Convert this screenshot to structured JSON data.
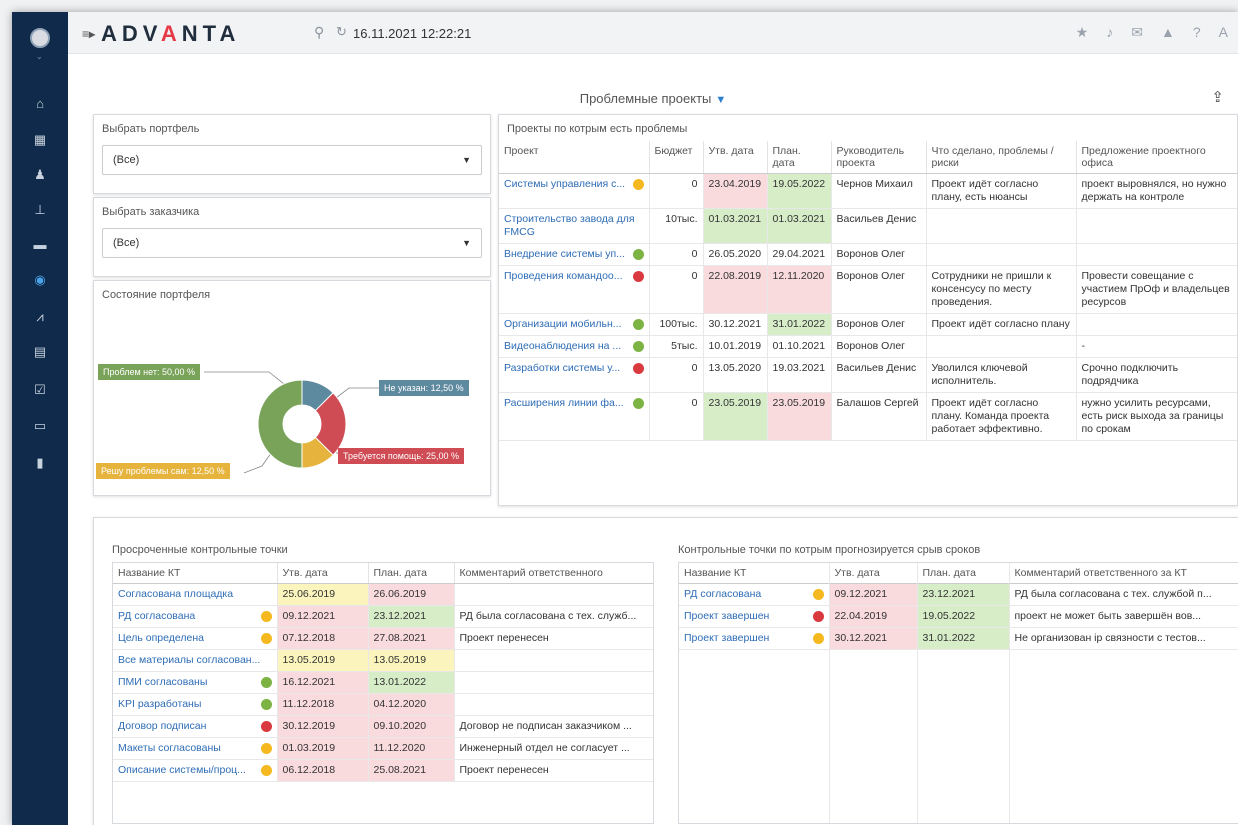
{
  "topbar": {
    "logo_pre": "ADV",
    "logo_a": "A",
    "logo_post": "NTA",
    "datetime": "16.11.2021 12:22:21"
  },
  "page": {
    "title": "Проблемные проекты"
  },
  "filters": {
    "portfolio_label": "Выбрать портфель",
    "portfolio_value": "(Все)",
    "customer_label": "Выбрать заказчика",
    "customer_value": "(Все)"
  },
  "portfolio_state": {
    "title": "Состояние портфеля",
    "labels": {
      "no_problems": "Проблем нет: 50,00 %",
      "not_specified": "Не указан: 12,50 %",
      "help_needed": "Требуется помощь: 25,00 %",
      "self_solve": "Решу проблемы сам: 12,50 %"
    },
    "chart_data": {
      "type": "pie",
      "categories": [
        "Проблем нет",
        "Не указан",
        "Требуется помощь",
        "Решу проблемы сам"
      ],
      "values": [
        50.0,
        12.5,
        25.0,
        12.5
      ],
      "colors": [
        "#7aa35a",
        "#5e8aa0",
        "#d04c55",
        "#e6b43c"
      ]
    }
  },
  "projects": {
    "title": "Проекты по котрым есть проблемы",
    "headers": [
      "Проект",
      "Бюджет",
      "Утв. дата",
      "План. дата",
      "Руководитель проекта",
      "Что сделано, проблемы / риски",
      "Предложение проектного офиса"
    ],
    "rows": [
      {
        "name": "Системы управления с...",
        "dot": "yellow",
        "budget": "0",
        "approved": "23.04.2019",
        "planned": "19.05.2022",
        "manager": "Чернов Михаил",
        "problems": "Проект идёт согласно плану, есть нюансы",
        "proposal": "проект выровнялся, но нужно держать на контроле",
        "approved_bg": "red",
        "planned_bg": "green"
      },
      {
        "name": "Строительство завода для FMCG",
        "dot": "",
        "budget": "10тыс.",
        "approved": "01.03.2021",
        "planned": "01.03.2021",
        "manager": "Васильев Денис",
        "problems": "",
        "proposal": "",
        "approved_bg": "green",
        "planned_bg": "green"
      },
      {
        "name": "Внедрение системы уп...",
        "dot": "green",
        "budget": "0",
        "approved": "26.05.2020",
        "planned": "29.04.2021",
        "manager": "Воронов Олег",
        "problems": "",
        "proposal": "",
        "approved_bg": "",
        "planned_bg": ""
      },
      {
        "name": "Проведения командоо...",
        "dot": "red",
        "budget": "0",
        "approved": "22.08.2019",
        "planned": "12.11.2020",
        "manager": "Воронов Олег",
        "problems": "Сотрудники не пришли к консенсусу по месту проведения.",
        "proposal": "Провести совещание с участием ПрОф и владельцев ресурсов",
        "approved_bg": "red",
        "planned_bg": "red"
      },
      {
        "name": "Организации мобильн...",
        "dot": "green",
        "budget": "100тыс.",
        "approved": "30.12.2021",
        "planned": "31.01.2022",
        "manager": "Воронов Олег",
        "problems": "Проект идёт согласно плану",
        "proposal": "",
        "approved_bg": "",
        "planned_bg": "green"
      },
      {
        "name": "Видеонаблюдения на ...",
        "dot": "green",
        "budget": "5тыс.",
        "approved": "10.01.2019",
        "planned": "01.10.2021",
        "manager": "Воронов Олег",
        "problems": "",
        "proposal": "-",
        "approved_bg": "",
        "planned_bg": ""
      },
      {
        "name": "Разработки системы у...",
        "dot": "red",
        "budget": "0",
        "approved": "13.05.2020",
        "planned": "19.03.2021",
        "manager": "Васильев Денис",
        "problems": "Уволился ключевой исполнитель.",
        "proposal": "Срочно подключить подрядчика",
        "approved_bg": "",
        "planned_bg": ""
      },
      {
        "name": "Расширения линии фа...",
        "dot": "green",
        "budget": "0",
        "approved": "23.05.2019",
        "planned": "23.05.2019",
        "manager": "Балашов Сергей",
        "problems": "Проект идёт согласно плану. Команда проекта работает эффективно.",
        "proposal": "нужно усилить ресурсами, есть риск выхода за границы по срокам",
        "approved_bg": "green",
        "planned_bg": "red"
      }
    ]
  },
  "overdue": {
    "title": "Просроченные контрольные точки",
    "headers": [
      "Название КТ",
      "Утв. дата",
      "План. дата",
      "Комментарий ответственного"
    ],
    "rows": [
      {
        "name": "Согласована площадка",
        "dot": "",
        "approved": "25.06.2019",
        "planned": "26.06.2019",
        "comment": "",
        "approved_bg": "yellow",
        "planned_bg": "red"
      },
      {
        "name": "РД согласована",
        "dot": "yellow",
        "approved": "09.12.2021",
        "planned": "23.12.2021",
        "comment": "РД была согласована с тех. служб...",
        "approved_bg": "red",
        "planned_bg": "green"
      },
      {
        "name": "Цель определена",
        "dot": "yellow",
        "approved": "07.12.2018",
        "planned": "27.08.2021",
        "comment": "Проект перенесен",
        "approved_bg": "red",
        "planned_bg": "red"
      },
      {
        "name": "Все материалы согласован...",
        "dot": "",
        "approved": "13.05.2019",
        "planned": "13.05.2019",
        "comment": "",
        "approved_bg": "yellow",
        "planned_bg": "yellow"
      },
      {
        "name": "ПМИ согласованы",
        "dot": "green",
        "approved": "16.12.2021",
        "planned": "13.01.2022",
        "comment": "",
        "approved_bg": "red",
        "planned_bg": "green"
      },
      {
        "name": "KPI разработаны",
        "dot": "green",
        "approved": "11.12.2018",
        "planned": "04.12.2020",
        "comment": "",
        "approved_bg": "red",
        "planned_bg": "red"
      },
      {
        "name": "Договор подписан",
        "dot": "red",
        "approved": "30.12.2019",
        "planned": "09.10.2020",
        "comment": "Договор не подписан заказчиком ...",
        "approved_bg": "red",
        "planned_bg": "red"
      },
      {
        "name": "Макеты согласованы",
        "dot": "yellow",
        "approved": "01.03.2019",
        "planned": "11.12.2020",
        "comment": "Инженерный отдел не согласует ...",
        "approved_bg": "red",
        "planned_bg": "red"
      },
      {
        "name": "Описание системы/проц...",
        "dot": "yellow",
        "approved": "06.12.2018",
        "planned": "25.08.2021",
        "comment": "Проект перенесен",
        "approved_bg": "red",
        "planned_bg": "red"
      }
    ]
  },
  "forecast": {
    "title": "Контрольные точки по котрым прогнозируется срыв сроков",
    "headers": [
      "Название КТ",
      "Утв. дата",
      "План. дата",
      "Комментарий ответственного за КТ"
    ],
    "rows": [
      {
        "name": "РД согласована",
        "dot": "yellow",
        "approved": "09.12.2021",
        "planned": "23.12.2021",
        "comment": "РД была согласована с тех. службой п...",
        "approved_bg": "red",
        "planned_bg": "green"
      },
      {
        "name": "Проект завершен",
        "dot": "red",
        "approved": "22.04.2019",
        "planned": "19.05.2022",
        "comment": "проект не может быть завершён вов...",
        "approved_bg": "red",
        "planned_bg": "green"
      },
      {
        "name": "Проект завершен",
        "dot": "yellow",
        "approved": "30.12.2021",
        "planned": "31.01.2022",
        "comment": "Не организован ip связности с тестов...",
        "approved_bg": "red",
        "planned_bg": "green"
      }
    ]
  },
  "colors": {
    "sidebar": "#0f2a4a",
    "link": "#2e6cb5",
    "dot_green": "#7cb342",
    "dot_yellow": "#f5b81e",
    "dot_red": "#d93a3f"
  },
  "icons": [
    "home-icon",
    "calendar-icon",
    "users-icon",
    "hierarchy-icon",
    "chat-icon",
    "circle-icon",
    "chart-icon",
    "archive-icon",
    "edit-icon",
    "card-icon",
    "bookmark-icon"
  ]
}
